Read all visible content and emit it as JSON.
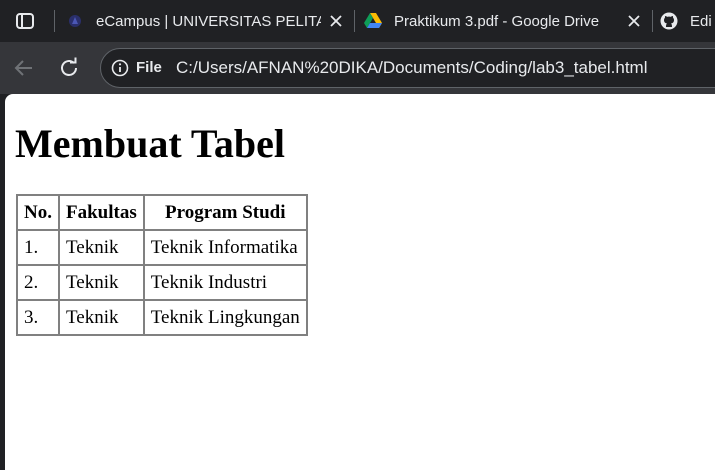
{
  "browser": {
    "tabs": [
      {
        "title": "eCampus | UNIVERSITAS PELITA BANGSA",
        "favicon": "ecampus-logo-icon",
        "active": false
      },
      {
        "title": "Praktikum 3.pdf - Google Drive",
        "favicon": "google-drive-icon",
        "active": false
      },
      {
        "title": "Edi",
        "favicon": "github-icon",
        "active": false
      }
    ],
    "omnibox": {
      "security_label": "File",
      "url": "C:/Users/AFNAN%20DIKA/Documents/Coding/lab3_tabel.html"
    },
    "colors": {
      "frame": "#202124",
      "toolbar": "#35363a",
      "text": "#e8eaed"
    }
  },
  "page": {
    "heading": "Membuat Tabel",
    "table": {
      "headers": [
        "No.",
        "Fakultas",
        "Program Studi"
      ],
      "rows": [
        [
          "1.",
          "Teknik",
          "Teknik Informatika"
        ],
        [
          "2.",
          "Teknik",
          "Teknik Industri"
        ],
        [
          "3.",
          "Teknik",
          "Teknik Lingkungan"
        ]
      ]
    }
  }
}
